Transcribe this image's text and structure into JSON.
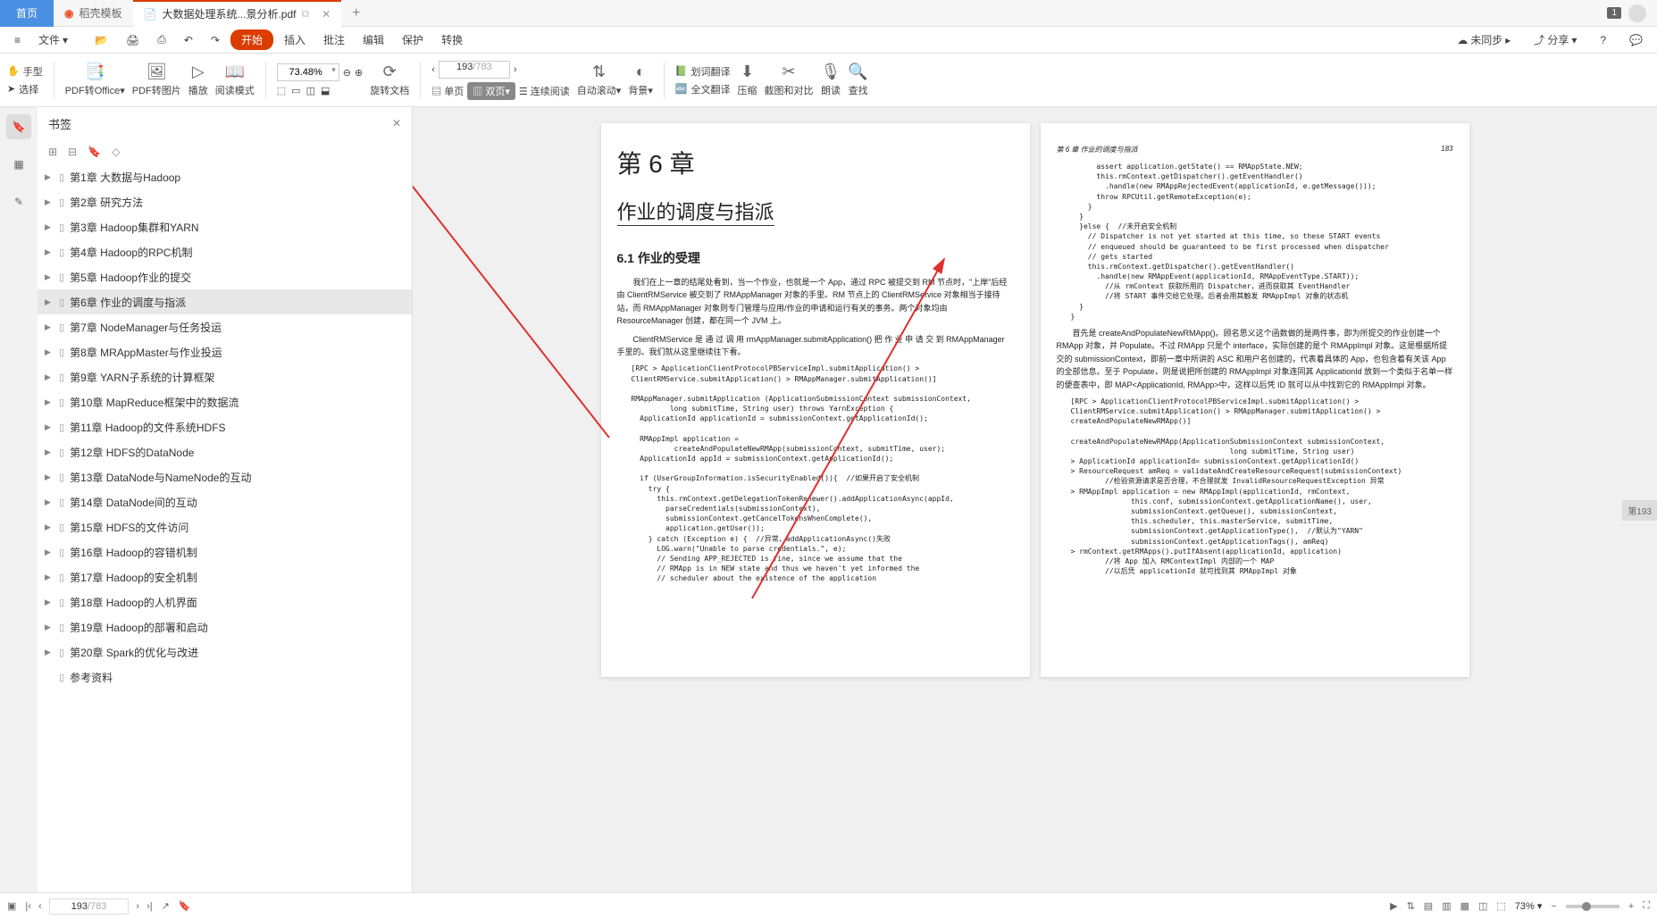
{
  "tabs": {
    "home": "首页",
    "doke": "稻壳模板",
    "active": "大数据处理系统...景分析.pdf"
  },
  "titlebar_badge": "1",
  "menubar": {
    "file": "文件",
    "start": "开始",
    "insert": "插入",
    "annotate": "批注",
    "edit": "编辑",
    "protect": "保护",
    "convert": "转换",
    "unsync": "未同步",
    "share": "分享"
  },
  "toolbar": {
    "hand": "手型",
    "select": "选择",
    "pdf2office": "PDF转Office",
    "pdf2img": "PDF转图片",
    "play": "播放",
    "readmode": "阅读模式",
    "zoom": "73.48%",
    "rotate": "旋转文档",
    "page_cur": "193",
    "page_total": "/783",
    "single": "单页",
    "double": "双页",
    "continuous": "连续阅读",
    "autoscroll": "自动滚动",
    "background": "背景",
    "word_trans": "划词翻译",
    "full_trans": "全文翻译",
    "compress": "压缩",
    "screenshot": "截图和对比",
    "readaloud": "朗读",
    "find": "查找"
  },
  "sidebar": {
    "title": "书签",
    "items": [
      "第1章 大数据与Hadoop",
      "第2章 研究方法",
      "第3章 Hadoop集群和YARN",
      "第4章 Hadoop的RPC机制",
      "第5章 Hadoop作业的提交",
      "第6章 作业的调度与指派",
      "第7章 NodeManager与任务投运",
      "第8章 MRAppMaster与作业投运",
      "第9章 YARN子系统的计算框架",
      "第10章 MapReduce框架中的数据流",
      "第11章 Hadoop的文件系统HDFS",
      "第12章 HDFS的DataNode",
      "第13章 DataNode与NameNode的互动",
      "第14章 DataNode间的互动",
      "第15章 HDFS的文件访问",
      "第16章 Hadoop的容错机制",
      "第17章 Hadoop的安全机制",
      "第18章 Hadoop的人机界面",
      "第19章 Hadoop的部署和启动",
      "第20章 Spark的优化与改进",
      "参考资料"
    ],
    "selected_index": 5
  },
  "page_left": {
    "chapter": "第 6 章",
    "title": "作业的调度与指派",
    "section": "6.1  作业的受理",
    "para1": "我们在上一章的结尾处看到，当一个作业，也就是一个 App，通过 RPC 被提交到 RM 节点时，\"上岸\"后经由 ClientRMService 被交到了 RMAppManager 对象的手里。RM 节点上的 ClientRMService 对象相当于接待站，而 RMAppManager 对象则专门管理与应用/作业的申请和运行有关的事务。两个对象均由 ResourceManager 创建，都在同一个 JVM 上。",
    "para2": "ClientRMService 是 通 过 调 用 rmAppManager.submitApplication() 把 作 业 申 请 交 到 RMAppManager 手里的。我们就从这里继续往下看。",
    "code1": "[RPC > ApplicationClientProtocolPBServiceImpl.submitApplication() >\nClientRMService.submitApplication() > RMAppManager.submitApplication()]\n\nRMAppManager.submitApplication (ApplicationSubmissionContext submissionContext,\n         long submitTime, String user) throws YarnException {\n  ApplicationId applicationId = submissionContext.getApplicationId();\n\n  RMAppImpl application =\n          createAndPopulateNewRMApp(submissionContext, submitTime, user);\n  ApplicationId appId = submissionContext.getApplicationId();\n\n  if (UserGroupInformation.isSecurityEnabled()){  //如果开启了安全机制\n    try {\n      this.rmContext.getDelegationTokenRenewer().addApplicationAsync(appId,\n        parseCredentials(submissionContext),\n        submissionContext.getCancelTokensWhenComplete(),\n        application.getUser());\n    } catch (Exception e) {  //异常，addApplicationAsync()失败\n      LOG.warn(\"Unable to parse credentials.\", e);\n      // Sending APP_REJECTED is fine, since we assume that the\n      // RMApp is in NEW state and thus we haven't yet informed the\n      // scheduler about the existence of the application"
  },
  "page_right": {
    "header": "第 6 章  作业的调度与指派",
    "pagenum": "183",
    "code1": "      assert application.getState() == RMAppState.NEW;\n      this.rmContext.getDispatcher().getEventHandler()\n        .handle(new RMAppRejectedEvent(applicationId, e.getMessage()));\n      throw RPCUtil.getRemoteException(e);\n    }\n  }\n  }else {  //未开启安全机制\n    // Dispatcher is not yet started at this time, so these START events\n    // enqueued should be guaranteed to be first processed when dispatcher\n    // gets started\n    this.rmContext.getDispatcher().getEventHandler()\n      .handle(new RMAppEvent(applicationId, RMAppEventType.START));\n        //从 rmContext 获取所用的 Dispatcher，进而获取其 EventHandler\n        //将 START 事件交给它处理。后者会用其触发 RMAppImpl 对象的状态机\n  }\n}",
    "para1": "首先是 createAndPopulateNewRMApp()。顾名思义这个函数做的是两件事，即为所提交的作业创建一个 RMApp 对象，并 Populate。不过 RMApp 只是个 interface，实际创建的是个 RMAppImpl 对象。这是根据所提交的 submissionContext，即前一章中所讲的 ASC 和用户名创建的，代表着具体的 App，也包含着有关该 App 的全部信息。至于 Populate，则是说把所创建的 RMAppImpl 对象连同其 ApplicationId 放到一个类似于名单一样的便查表中，即 MAP<ApplicationId, RMApp>中，这样以后凭 ID 就可以从中找到它的 RMAppImpl 对象。",
    "code2": "[RPC > ApplicationClientProtocolPBServiceImpl.submitApplication() >\nClientRMService.submitApplication() > RMAppManager.submitApplication() >\ncreateAndPopulateNewRMApp()]\n\ncreateAndPopulateNewRMApp(ApplicationSubmissionContext submissionContext,\n                                     long submitTime, String user)\n> ApplicationId applicationId= submissionContext.getApplicationId()\n> ResourceRequest amReq = validateAndCreateResourceRequest(submissionContext)\n        //检验资源请求是否合理，不合理就发 InvalidResourceRequestException 异常\n> RMAppImpl application = new RMAppImpl(applicationId, rmContext,\n              this.conf, submissionContext.getApplicationName(), user,\n              submissionContext.getQueue(), submissionContext,\n              this.scheduler, this.masterService, submitTime,\n              submissionContext.getApplicationType(),  //默认为\"YARN\"\n              submissionContext.getApplicationTags(), amReq)\n> rmContext.getRMApps().putIfAbsent(applicationId, application)\n        //将 App 加入 RMContextImpl 内部的一个 MAP\n        //以后凭 applicationId 就可找到其 RMAppImpl 对象"
  },
  "page_badge": "第193",
  "statusbar": {
    "page_cur": "193",
    "page_total": "/783",
    "zoom": "73%"
  }
}
